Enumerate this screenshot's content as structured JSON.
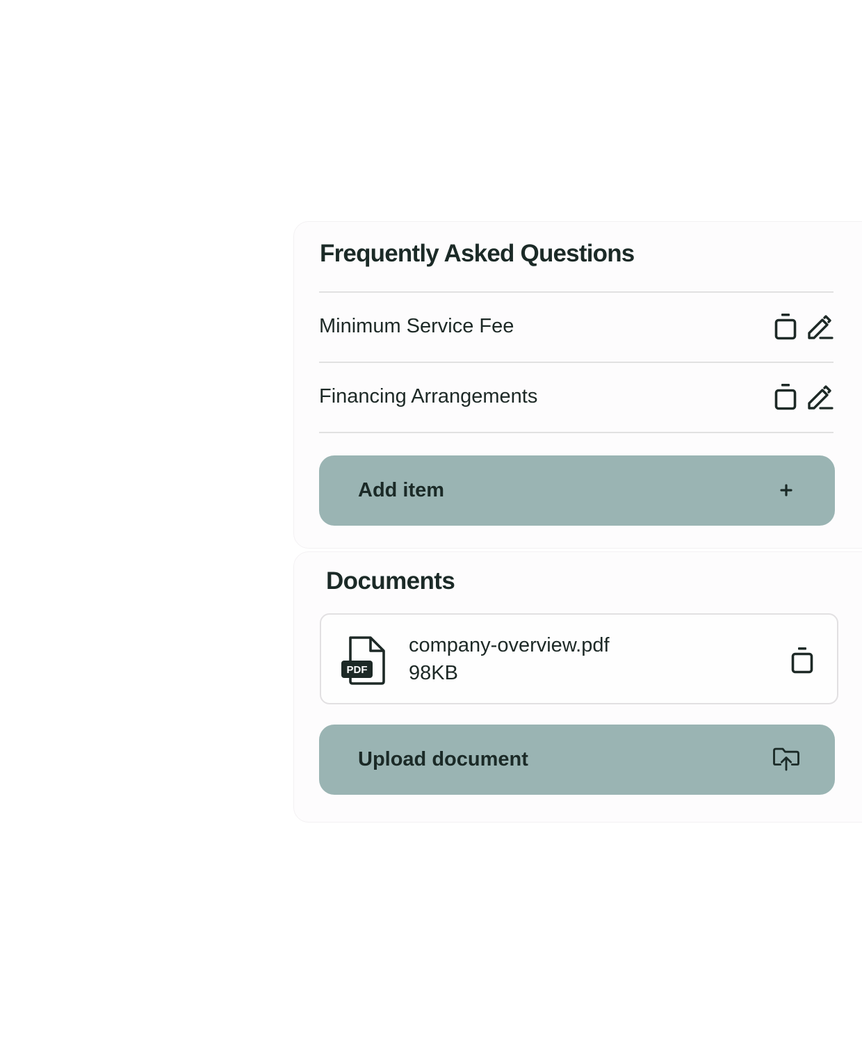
{
  "faq": {
    "title": "Frequently Asked Questions",
    "items": [
      {
        "label": "Minimum Service Fee"
      },
      {
        "label": "Financing Arrangements"
      }
    ],
    "add_button": {
      "label": "Add item",
      "icon": "plus-icon"
    }
  },
  "documents": {
    "title": "Documents",
    "files": [
      {
        "name": "company-overview.pdf",
        "size": "98KB",
        "badge": "PDF",
        "icon": "pdf-file-icon"
      }
    ],
    "upload_button": {
      "label": "Upload document",
      "icon": "upload-cloud-icon"
    }
  },
  "colors": {
    "button_bg": "#9ab4b3",
    "text": "#1c2a27",
    "card_bg": "#fdfcfd",
    "divider": "#e1e1e1"
  }
}
